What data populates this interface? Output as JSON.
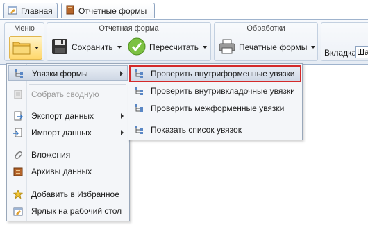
{
  "tabs": [
    {
      "label": "Главная",
      "icon": "home-tab-icon"
    },
    {
      "label": "Отчетные формы",
      "icon": "book-icon"
    }
  ],
  "ribbon": {
    "menu_group": {
      "title": "Меню"
    },
    "form_group": {
      "title": "Отчетная форма",
      "save_label": "Сохранить",
      "recalc_label": "Пересчитать"
    },
    "proc_group": {
      "title": "Обработки",
      "print_label": "Печатные формы"
    },
    "tab_group": {
      "label": "Вкладка",
      "value": "Ша"
    }
  },
  "menu": {
    "items": [
      {
        "label": "Увязки формы",
        "icon": "link-tree-icon",
        "submenu": true,
        "state": "active"
      },
      {
        "label": "Собрать сводную",
        "icon": "collect-icon",
        "state": "disabled"
      },
      {
        "label": "Экспорт данных",
        "icon": "export-icon",
        "submenu": true
      },
      {
        "label": "Импорт данных",
        "icon": "import-icon",
        "submenu": true
      },
      {
        "label": "Вложения",
        "icon": "paperclip-icon"
      },
      {
        "label": "Архивы данных",
        "icon": "archive-icon"
      },
      {
        "label": "Добавить в Избранное",
        "icon": "star-icon"
      },
      {
        "label": "Ярлык на рабочий стол",
        "icon": "shortcut-icon"
      }
    ]
  },
  "submenu": {
    "items": [
      {
        "label": "Проверить внутриформенные увязки",
        "icon": "link-tree-icon",
        "state": "highlighted"
      },
      {
        "label": "Проверить внутривкладочные увязки",
        "icon": "link-tree-icon"
      },
      {
        "label": "Проверить межформенные увязки",
        "icon": "link-tree-icon"
      },
      {
        "label": "Показать список увязок",
        "icon": "link-tree-icon"
      }
    ]
  },
  "colors": {
    "highlight_outline": "#d42a2a",
    "accent": "#ffd76a"
  }
}
